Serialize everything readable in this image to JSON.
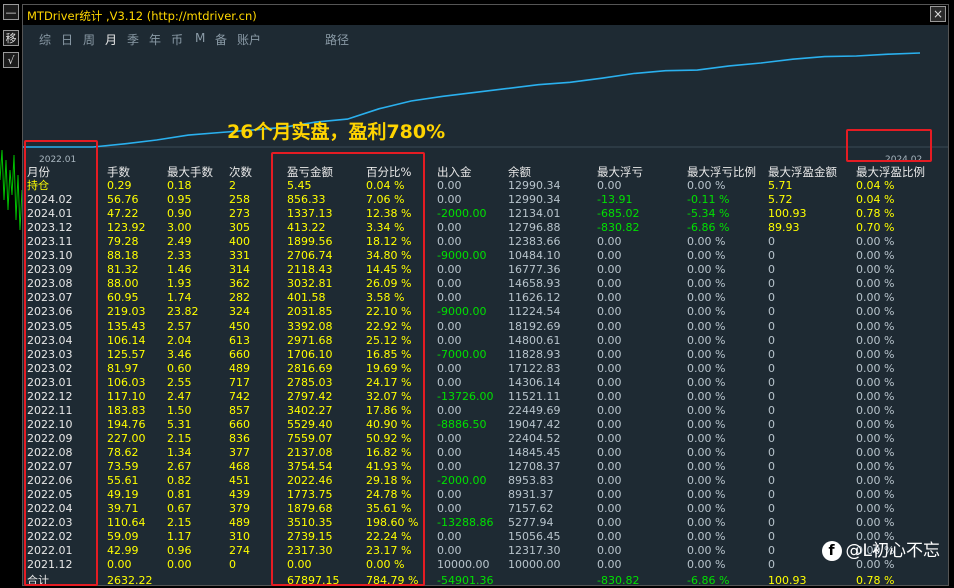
{
  "left_toolbar": {
    "minimize": "—",
    "move": "移",
    "check": "√"
  },
  "window": {
    "title": "MTDriver统计 ,V3.12 (http://mtdriver.cn)",
    "close": "×"
  },
  "tabs": [
    {
      "label": "综",
      "active": false
    },
    {
      "label": "日",
      "active": false
    },
    {
      "label": "周",
      "active": false
    },
    {
      "label": "月",
      "active": true
    },
    {
      "label": "季",
      "active": false
    },
    {
      "label": "年",
      "active": false
    },
    {
      "label": "币",
      "active": false
    },
    {
      "label": "M",
      "active": false
    },
    {
      "label": "备",
      "active": false
    },
    {
      "label": "账户",
      "active": false
    },
    {
      "label": "路径",
      "active": false
    }
  ],
  "chart": {
    "start_label": "2022.01",
    "end_label": "2024.02"
  },
  "annotation": "26个月实盘，盈利780%",
  "colors": {
    "yellow": "#ffff00",
    "white": "#e8e8e8",
    "green": "#00e000",
    "gray": "#b8c4cc",
    "line": "#2ab0ee",
    "red": "#e51c23"
  },
  "columns": [
    "月份",
    "手数",
    "最大手数",
    "次数",
    "盈亏金额",
    "百分比%",
    "出入金",
    "余额",
    "最大浮亏",
    "最大浮亏比例",
    "最大浮盈金额",
    "最大浮盈比例"
  ],
  "rows": [
    [
      "持仓",
      "0.29",
      "0.18",
      "2",
      "5.45",
      "0.04 %",
      "0.00",
      "12990.34",
      "0.00",
      "0.00 %",
      "5.71",
      "0.04 %"
    ],
    [
      "2024.02",
      "56.76",
      "0.95",
      "258",
      "856.33",
      "7.06 %",
      "0.00",
      "12990.34",
      "-13.91",
      "-0.11 %",
      "5.72",
      "0.04 %"
    ],
    [
      "2024.01",
      "47.22",
      "0.90",
      "273",
      "1337.13",
      "12.38 %",
      "-2000.00",
      "12134.01",
      "-685.02",
      "-5.34 %",
      "100.93",
      "0.78 %"
    ],
    [
      "2023.12",
      "123.92",
      "3.00",
      "305",
      "413.22",
      "3.34 %",
      "0.00",
      "12796.88",
      "-830.82",
      "-6.86 %",
      "89.93",
      "0.70 %"
    ],
    [
      "2023.11",
      "79.28",
      "2.49",
      "400",
      "1899.56",
      "18.12 %",
      "0.00",
      "12383.66",
      "0.00",
      "0.00 %",
      "0",
      "0.00 %"
    ],
    [
      "2023.10",
      "88.18",
      "2.33",
      "331",
      "2706.74",
      "34.80 %",
      "-9000.00",
      "10484.10",
      "0.00",
      "0.00 %",
      "0",
      "0.00 %"
    ],
    [
      "2023.09",
      "81.32",
      "1.46",
      "314",
      "2118.43",
      "14.45 %",
      "0.00",
      "16777.36",
      "0.00",
      "0.00 %",
      "0",
      "0.00 %"
    ],
    [
      "2023.08",
      "88.00",
      "1.93",
      "362",
      "3032.81",
      "26.09 %",
      "0.00",
      "14658.93",
      "0.00",
      "0.00 %",
      "0",
      "0.00 %"
    ],
    [
      "2023.07",
      "60.95",
      "1.74",
      "282",
      "401.58",
      "3.58 %",
      "0.00",
      "11626.12",
      "0.00",
      "0.00 %",
      "0",
      "0.00 %"
    ],
    [
      "2023.06",
      "219.03",
      "23.82",
      "324",
      "2031.85",
      "22.10 %",
      "-9000.00",
      "11224.54",
      "0.00",
      "0.00 %",
      "0",
      "0.00 %"
    ],
    [
      "2023.05",
      "135.43",
      "2.57",
      "450",
      "3392.08",
      "22.92 %",
      "0.00",
      "18192.69",
      "0.00",
      "0.00 %",
      "0",
      "0.00 %"
    ],
    [
      "2023.04",
      "106.14",
      "2.04",
      "613",
      "2971.68",
      "25.12 %",
      "0.00",
      "14800.61",
      "0.00",
      "0.00 %",
      "0",
      "0.00 %"
    ],
    [
      "2023.03",
      "125.57",
      "3.46",
      "660",
      "1706.10",
      "16.85 %",
      "-7000.00",
      "11828.93",
      "0.00",
      "0.00 %",
      "0",
      "0.00 %"
    ],
    [
      "2023.02",
      "81.97",
      "0.60",
      "489",
      "2816.69",
      "19.69 %",
      "0.00",
      "17122.83",
      "0.00",
      "0.00 %",
      "0",
      "0.00 %"
    ],
    [
      "2023.01",
      "106.03",
      "2.55",
      "717",
      "2785.03",
      "24.17 %",
      "0.00",
      "14306.14",
      "0.00",
      "0.00 %",
      "0",
      "0.00 %"
    ],
    [
      "2022.12",
      "117.10",
      "2.47",
      "742",
      "2797.42",
      "32.07 %",
      "-13726.00",
      "11521.11",
      "0.00",
      "0.00 %",
      "0",
      "0.00 %"
    ],
    [
      "2022.11",
      "183.83",
      "1.50",
      "857",
      "3402.27",
      "17.86 %",
      "0.00",
      "22449.69",
      "0.00",
      "0.00 %",
      "0",
      "0.00 %"
    ],
    [
      "2022.10",
      "194.76",
      "5.31",
      "660",
      "5529.40",
      "40.90 %",
      "-8886.50",
      "19047.42",
      "0.00",
      "0.00 %",
      "0",
      "0.00 %"
    ],
    [
      "2022.09",
      "227.00",
      "2.15",
      "836",
      "7559.07",
      "50.92 %",
      "0.00",
      "22404.52",
      "0.00",
      "0.00 %",
      "0",
      "0.00 %"
    ],
    [
      "2022.08",
      "78.62",
      "1.34",
      "377",
      "2137.08",
      "16.82 %",
      "0.00",
      "14845.45",
      "0.00",
      "0.00 %",
      "0",
      "0.00 %"
    ],
    [
      "2022.07",
      "73.59",
      "2.67",
      "468",
      "3754.54",
      "41.93 %",
      "0.00",
      "12708.37",
      "0.00",
      "0.00 %",
      "0",
      "0.00 %"
    ],
    [
      "2022.06",
      "55.61",
      "0.82",
      "451",
      "2022.46",
      "29.18 %",
      "-2000.00",
      "8953.83",
      "0.00",
      "0.00 %",
      "0",
      "0.00 %"
    ],
    [
      "2022.05",
      "49.19",
      "0.81",
      "439",
      "1773.75",
      "24.78 %",
      "0.00",
      "8931.37",
      "0.00",
      "0.00 %",
      "0",
      "0.00 %"
    ],
    [
      "2022.04",
      "39.71",
      "0.67",
      "379",
      "1879.68",
      "35.61 %",
      "0.00",
      "7157.62",
      "0.00",
      "0.00 %",
      "0",
      "0.00 %"
    ],
    [
      "2022.03",
      "110.64",
      "2.15",
      "489",
      "3510.35",
      "198.60 %",
      "-13288.86",
      "5277.94",
      "0.00",
      "0.00 %",
      "0",
      "0.00 %"
    ],
    [
      "2022.02",
      "59.09",
      "1.17",
      "310",
      "2739.15",
      "22.24 %",
      "0.00",
      "15056.45",
      "0.00",
      "0.00 %",
      "0",
      "0.00 %"
    ],
    [
      "2022.01",
      "42.99",
      "0.96",
      "274",
      "2317.30",
      "23.17 %",
      "0.00",
      "12317.30",
      "0.00",
      "0.00 %",
      "0",
      "0.00 %"
    ],
    [
      "2021.12",
      "0.00",
      "0.00",
      "0",
      "0.00",
      "0.00 %",
      "10000.00",
      "10000.00",
      "0.00",
      "0.00 %",
      "0",
      "0.00 %"
    ]
  ],
  "total_row": [
    "合计",
    "2632.22",
    "",
    "",
    "67897.15",
    "784.79 %",
    "-54901.36",
    "",
    "-830.82",
    "-6.86 %",
    "100.93",
    "0.78 %"
  ],
  "balance_curve": {
    "months": [
      "2021.12",
      "2022.01",
      "2022.02",
      "2022.03",
      "2022.04",
      "2022.05",
      "2022.06",
      "2022.07",
      "2022.08",
      "2022.09",
      "2022.10",
      "2022.11",
      "2022.12",
      "2023.01",
      "2023.02",
      "2023.03",
      "2023.04",
      "2023.05",
      "2023.06",
      "2023.07",
      "2023.08",
      "2023.09",
      "2023.10",
      "2023.11",
      "2023.12",
      "2024.01",
      "2024.02"
    ],
    "cumulative_profit": [
      0,
      2317.3,
      5056.45,
      8566.8,
      10446.48,
      12220.23,
      14242.69,
      17997.23,
      20134.31,
      27693.38,
      33222.78,
      36625.05,
      39422.47,
      42207.5,
      45024.19,
      46730.29,
      49701.97,
      53094.05,
      55125.9,
      55527.48,
      58560.29,
      60678.72,
      63385.46,
      65285.02,
      65698.24,
      67035.37,
      67891.7
    ]
  },
  "watermark": "@L初心不忘",
  "watermark_icon": "f"
}
